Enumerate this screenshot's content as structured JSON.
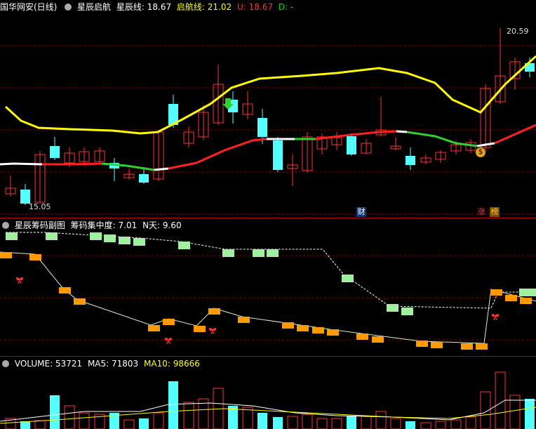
{
  "main": {
    "stock_name": "国华网安(日线)",
    "indicator": "星辰启航",
    "line1_label": "星辰线: 18.67",
    "line2_label": "启航线: 21.02",
    "u_label": "U: 18.67",
    "d_label": "D: -",
    "high_price": "20.59",
    "low_price": "15.05",
    "tag_cai": "财",
    "tag_zhang": "涨",
    "tag_bang": "榜",
    "coin_symbol": "$"
  },
  "chip": {
    "title": "星辰筹码副图",
    "concentration_label": "筹码集中度: 7.01",
    "n_label": "N天: 9.60"
  },
  "volume": {
    "label": "VOLUME: 53721",
    "ma5_label": "MA5: 71803",
    "ma10_label": "MA10: 98666"
  },
  "colors": {
    "up": "#ff3232",
    "down": "#54ffff",
    "yellow": "#ffff00",
    "grid": "#8b0000",
    "orange": "#ff9900",
    "lightgreen": "#a0f0a0"
  }
}
